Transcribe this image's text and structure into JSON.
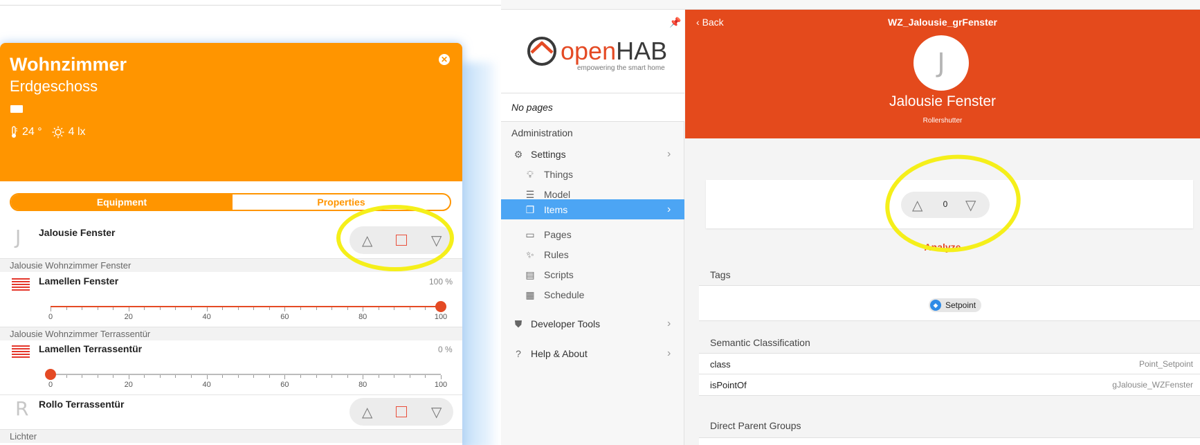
{
  "left": {
    "room": {
      "title": "Wohnzimmer",
      "subtitle": "Erdgeschoss",
      "temperature": "24 °",
      "brightness": "4 lx"
    },
    "tabs": {
      "equipment": "Equipment",
      "properties": "Properties"
    },
    "items": [
      {
        "letter": "J",
        "title": "Jalousie Fenster"
      },
      {
        "title": "Lamellen Fenster",
        "percent_label": "100 %",
        "value": 100
      },
      {
        "title": "Lamellen Terrassentür",
        "percent_label": "0 %",
        "value": 0
      },
      {
        "letter": "R",
        "title": "Rollo Terrassentür"
      }
    ],
    "groups": [
      "Jalousie Wohnzimmer Fenster",
      "Jalousie Wohnzimmer Terrassentür",
      "Lichter"
    ],
    "slider_ticks": [
      "0",
      "20",
      "40",
      "60",
      "80",
      "100"
    ],
    "colors": {
      "header": "#ff9500",
      "accent": "#e44a24",
      "highlight": "#f5ef1a"
    }
  },
  "right": {
    "logo": {
      "open": "open",
      "hab": "HAB",
      "tagline": "empowering the smart home"
    },
    "no_pages": "No pages",
    "admin_title": "Administration",
    "nav": {
      "settings": "Settings",
      "things": "Things",
      "model": "Model",
      "items": "Items",
      "pages": "Pages",
      "rules": "Rules",
      "scripts": "Scripts",
      "schedule": "Schedule",
      "developer_tools": "Developer Tools",
      "help_about": "Help & About"
    },
    "header": {
      "back": "Back",
      "item_name": "WZ_Jalousie_grFenster",
      "avatar_letter": "J",
      "label": "Jalousie Fenster",
      "type": "Rollershutter"
    },
    "control": {
      "value": "0"
    },
    "analyze": "Analyze",
    "tags_title": "Tags",
    "tag": "Setpoint",
    "semantic_title": "Semantic Classification",
    "semantic": [
      {
        "key": "class",
        "value": "Point_Setpoint"
      },
      {
        "key": "isPointOf",
        "value": "gJalousie_WZFenster"
      }
    ],
    "parents_title": "Direct Parent Groups",
    "colors": {
      "header": "#e44a1c",
      "nav_active": "#4ca5f4",
      "tag_icon": "#2f8be6"
    }
  }
}
